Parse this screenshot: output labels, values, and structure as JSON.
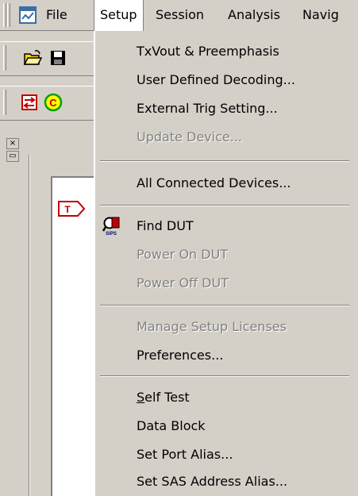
{
  "menubar": {
    "items": [
      {
        "label": "File"
      },
      {
        "label": "Setup"
      },
      {
        "label": "Session"
      },
      {
        "label": "Analysis"
      },
      {
        "label": "Navig"
      }
    ]
  },
  "setup_menu": {
    "items": [
      {
        "label": "TxVout & Preemphasis",
        "enabled": true
      },
      {
        "label": "User Defined Decoding...",
        "enabled": true
      },
      {
        "label": "External Trig Setting...",
        "enabled": true
      },
      {
        "label": "Update Device...",
        "enabled": false
      },
      {
        "label": "All Connected Devices...",
        "enabled": true
      },
      {
        "label": "Find DUT",
        "enabled": true,
        "icon": "find-dut-icon"
      },
      {
        "label": "Power On DUT",
        "enabled": false
      },
      {
        "label": "Power Off DUT",
        "enabled": false
      },
      {
        "label": "Manage Setup Licenses",
        "enabled": false
      },
      {
        "label": "Preferences...",
        "enabled": true
      },
      {
        "label_first": "S",
        "label_rest": "elf Test",
        "enabled": true
      },
      {
        "label": "Data Block",
        "enabled": true
      },
      {
        "label": "Set Port Alias...",
        "enabled": true
      },
      {
        "label": "Set SAS Address Alias...",
        "enabled": true
      }
    ]
  },
  "icons": {
    "app": "app-window-icon",
    "open": "open-folder-icon",
    "save": "save-disk-icon",
    "swap": "swap-arrows-icon",
    "capture": "capture-c-icon",
    "trigger_tag": "trigger-tag-icon",
    "find_dut": "find-dut-icon"
  },
  "colors": {
    "face": "#d4d0c8",
    "shadow": "#808080",
    "highlight": "#ffffff",
    "disabled_text": "#808080"
  }
}
